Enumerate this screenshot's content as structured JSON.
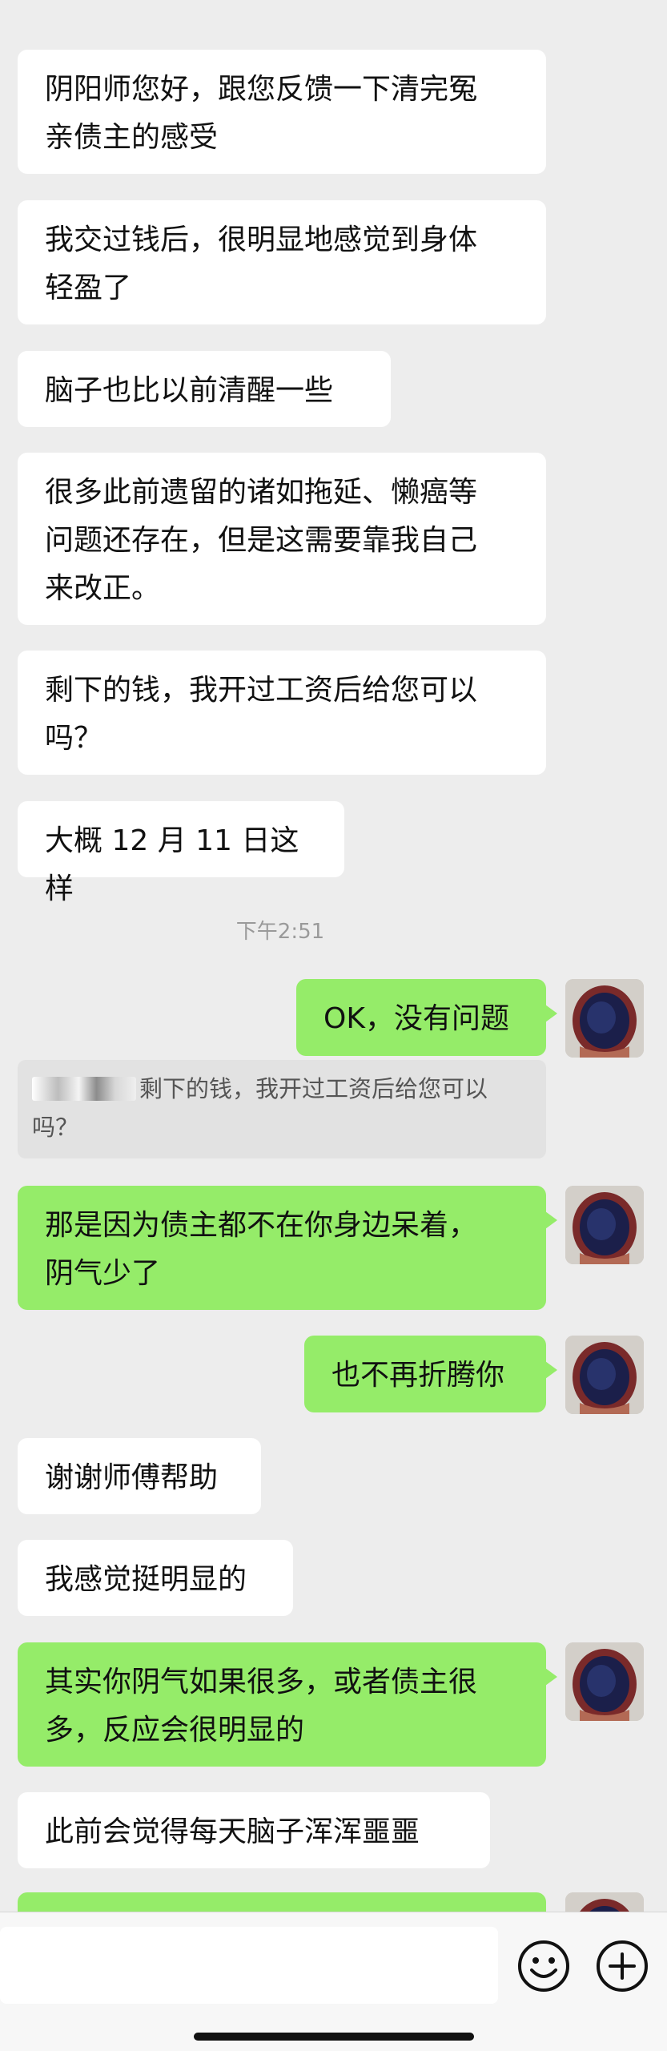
{
  "chat": {
    "incoming": [
      {
        "text": "阴阳师您好，跟您反馈一下清完冤\n亲债主的感受"
      },
      {
        "text": "我交过钱后，很明显地感觉到身体\n轻盈了"
      },
      {
        "text": "脑子也比以前清醒一些"
      },
      {
        "text": "很多此前遗留的诸如拖延、懒癌等\n问题还存在，但是这需要靠我自己\n来改正。"
      },
      {
        "text": "剩下的钱，我开过工资后给您可以\n吗？"
      },
      {
        "text": "大概 12 月 11 日这样"
      },
      {
        "text": "谢谢师傅帮助"
      },
      {
        "text": "我感觉挺明显的"
      },
      {
        "text": "此前会觉得每天脑子浑浑噩噩"
      }
    ],
    "timestamp": "下午2:51",
    "outgoing": [
      {
        "text": "OK，没有问题"
      },
      {
        "text": "那是因为债主都不在你身边呆着，\n阴气少了"
      },
      {
        "text": "也不再折腾你"
      },
      {
        "text": "其实你阴气如果很多，或者债主很\n多，反应会很明显的"
      },
      {
        "text": ""
      }
    ],
    "quote": {
      "sender": "■■.■",
      "text": "剩下的钱，我开过工资后给您可以吗？"
    }
  },
  "input_bar": {
    "emoji_icon": "emoji-icon",
    "plus_icon": "plus-icon"
  },
  "colors": {
    "background": "#ededed",
    "incoming_bubble": "#ffffff",
    "outgoing_bubble": "#95ec69",
    "timestamp_text": "#9a9a9a",
    "quote_background": "#e2e2e2"
  }
}
